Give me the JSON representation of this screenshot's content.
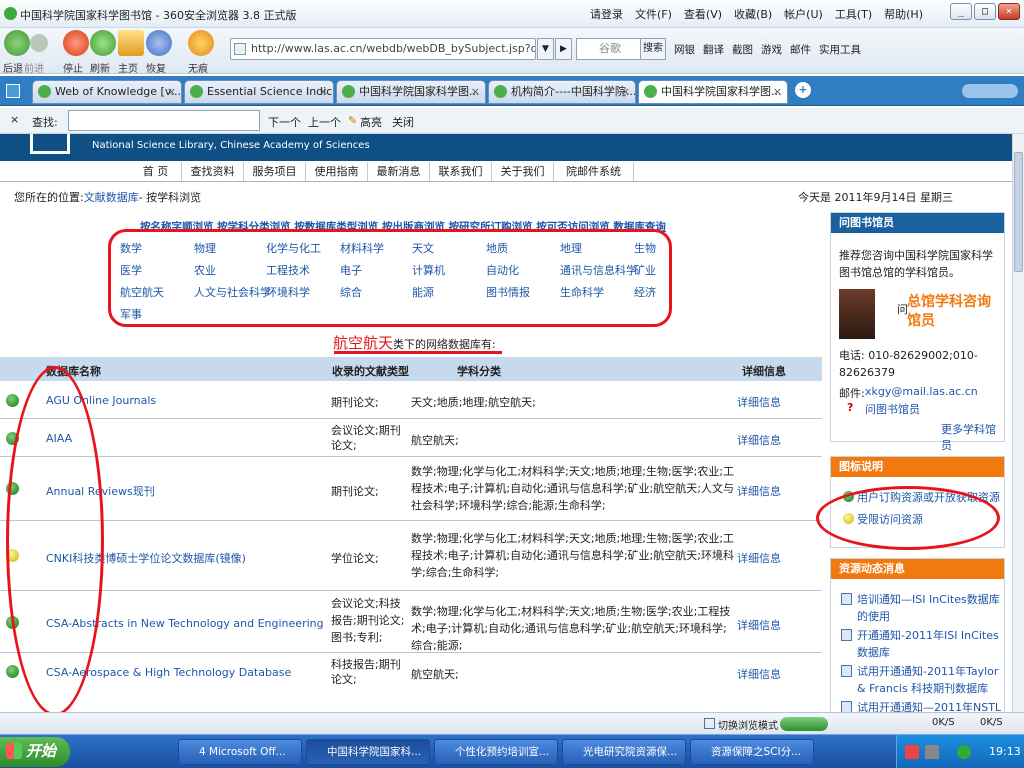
{
  "window": {
    "title": "中国科学院国家科学图书馆 - 360安全浏览器 3.8 正式版",
    "login": "请登录",
    "menus": [
      "文件(F)",
      "查看(V)",
      "收藏(B)",
      "帐户(U)",
      "工具(T)",
      "帮助(H)"
    ]
  },
  "nav": {
    "buttons": [
      "后退",
      "前进",
      "停止",
      "刷新",
      "主页",
      "恢复",
      "无痕"
    ],
    "address": "http://www.las.ac.cn/webdb/webDB_bySubject.jsp?dbcl",
    "search_placeholder": "谷歌",
    "search_button": "搜索",
    "tools": [
      "网银",
      "翻译",
      "截图",
      "游戏",
      "邮件",
      "实用工具"
    ]
  },
  "tabs": [
    "Web of Knowledge [v...",
    "Essential Science Indic...",
    "中国科学院国家科学图...",
    "机构简介----中国科学院...",
    "中国科学院国家科学图..."
  ],
  "find": {
    "label": "查找:",
    "next": "下一个",
    "prev": "上一个",
    "highlight": "高亮",
    "close": "关闭"
  },
  "site": {
    "name": "National Science Library, Chinese Academy of Sciences",
    "menu": [
      "首 页",
      "查找资料",
      "服务项目",
      "使用指南",
      "最新消息",
      "联系我们",
      "关于我们",
      "院邮件系统"
    ],
    "breadcrumb_prefix": "您所在的位置:",
    "breadcrumb_link": "文献数据库",
    "breadcrumb_rest": "- 按学科浏览",
    "date": "今天是 2011年9月14日 星期三"
  },
  "browse_links": "按名称字顺浏览  按学科分类浏览  按数据库类型浏览  按出版商浏览  按研究所订购浏览  按可否访问浏览  数据库查询",
  "subjects": [
    "数学",
    "物理",
    "化学与化工",
    "材料科学",
    "天文",
    "地质",
    "地理",
    "生物",
    "医学",
    "农业",
    "工程技术",
    "电子",
    "计算机",
    "自动化",
    "通讯与信息科学",
    "矿业",
    "航空航天",
    "人文与社会科学",
    "环境科学",
    "综合",
    "能源",
    "图书情报",
    "生命科学",
    "经济",
    "军事"
  ],
  "result": {
    "category": "航空航天",
    "suffix": "类下的网络数据库有:"
  },
  "table": {
    "headers": [
      "数据库名称",
      "收录的文献类型",
      "学科分类",
      "详细信息"
    ],
    "rows": [
      {
        "status": "green",
        "name": "AGU Online Journals",
        "type": "期刊论文;",
        "subject": "天文;地质;地理;航空航天;",
        "detail": "详细信息"
      },
      {
        "status": "green",
        "name": "AIAA",
        "type": "会议论文;期刊论文;",
        "subject": "航空航天;",
        "detail": "详细信息"
      },
      {
        "status": "green",
        "name": "Annual Reviews现刊",
        "type": "期刊论文;",
        "subject": "数学;物理;化学与化工;材料科学;天文;地质;地理;生物;医学;农业;工程技术;电子;计算机;自动化;通讯与信息科学;矿业;航空航天;人文与社会科学;环境科学;综合;能源;生命科学;",
        "detail": "详细信息"
      },
      {
        "status": "yellow",
        "name": "CNKI科技类博硕士学位论文数据库(镜像)",
        "type": "学位论文;",
        "subject": "数学;物理;化学与化工;材料科学;天文;地质;地理;生物;医学;农业;工程技术;电子;计算机;自动化;通讯与信息科学;矿业;航空航天;环境科学;综合;生命科学;",
        "detail": "详细信息"
      },
      {
        "status": "green",
        "name": "CSA-Abstracts in New Technology and Engineering",
        "type": "会议论文;科技报告;期刊论文;图书;专利;",
        "subject": "数学;物理;化学与化工;材料科学;天文;地质;生物;医学;农业;工程技术;电子;计算机;自动化;通讯与信息科学;矿业;航空航天;环境科学;综合;能源;",
        "detail": "详细信息"
      },
      {
        "status": "green",
        "name": "CSA-Aerospace & High Technology Database",
        "type": "科技报告;期刊论文;",
        "subject": "航空航天;",
        "detail": "详细信息"
      }
    ]
  },
  "sidebar": {
    "ask": {
      "title": "问图书馆员",
      "text": "推荐您咨询中国科学院国家科学图书馆总馆的学科馆员。",
      "ask_prefix": "问",
      "ask_big": "总馆学科咨询馆员",
      "phone": "电话: 010-82629002;010-82626379",
      "email_label": "邮件:",
      "email": "xkgy@mail.las.ac.cn",
      "ask_link": "问图书馆员",
      "more": "更多学科馆员"
    },
    "legend": {
      "title": "图标说明",
      "items": [
        "用户订购资源或开放获取资源",
        "受限访问资源"
      ]
    },
    "news": {
      "title": "资源动态消息",
      "items": [
        "培训通知—ISI InCites数据库的使用",
        "开通通知-2011年ISI InCites数据库",
        "试用开通通知-2011年Taylor & Francis 科技期刊数据库",
        "试用开通通知—2011年NSTL"
      ]
    }
  },
  "status": {
    "mode": "切换浏览模式",
    "down": "0K/S",
    "up": "0K/S"
  },
  "taskbar": {
    "start": "开始",
    "tasks": [
      "4 Microsoft Off...",
      "中国科学院国家科...",
      "个性化预约培训宣...",
      "光电研究院资源保...",
      "资源保障之SCI分..."
    ],
    "time": "19:13"
  },
  "colors": {
    "accent": "#e8141c",
    "link": "#1e57a8",
    "header": "#0f4f86",
    "sidebar_header": "#1a5f9e",
    "orange": "#f07a10"
  }
}
